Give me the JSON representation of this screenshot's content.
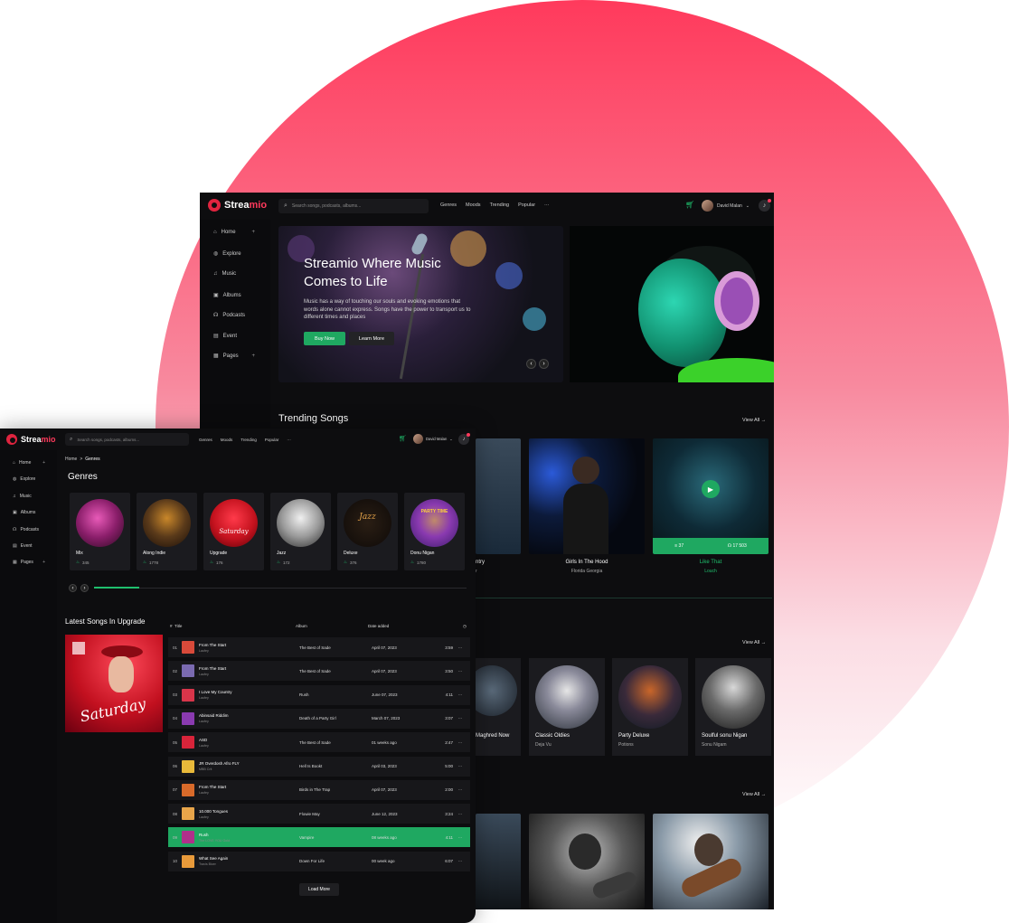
{
  "colors": {
    "accent": "#1fbf6d",
    "brand": "#e0243f",
    "background": "#0d0d0f"
  },
  "app": {
    "name_a": "Strea",
    "name_b": "mio"
  },
  "header": {
    "search_placeholder": "Search songs, podcasts, albums...",
    "nav": [
      "Genres",
      "Moods",
      "Trending",
      "Popular",
      "···"
    ],
    "user_name": "David Malan",
    "icons": [
      "cart-icon",
      "bell-icon",
      "chevron-down-icon",
      "search-icon"
    ]
  },
  "sidebar": {
    "items": [
      {
        "label": "Home",
        "icon": "home-icon",
        "plus": "+"
      },
      {
        "label": "Explore",
        "icon": "globe-icon",
        "plus": ""
      },
      {
        "label": "Music",
        "icon": "music-icon",
        "plus": ""
      },
      {
        "label": "Albums",
        "icon": "album-icon",
        "plus": ""
      },
      {
        "label": "Podcasts",
        "icon": "headphones-icon",
        "plus": ""
      },
      {
        "label": "Event",
        "icon": "calendar-icon",
        "plus": ""
      },
      {
        "label": "Pages",
        "icon": "pages-icon",
        "plus": "+"
      }
    ]
  },
  "hero": {
    "title": "Streamio Where Music Comes to Life",
    "text": "Music has a way of touching our souls and evoking emotions that words alone cannot express. Songs have the power to transport us to different times and places",
    "buy_label": "Buy Now",
    "learn_label": "Learn More",
    "prev": "‹",
    "next": "›"
  },
  "trending": {
    "title": "Trending Songs",
    "view_all": "View All",
    "cards": [
      {
        "title": "Girls In The Hood",
        "artist": "Florida Georgia"
      },
      {
        "title": "Like That",
        "artist": "Louch",
        "likes": "37",
        "plays": "17 503"
      }
    ],
    "partial_title": "ntry",
    "partial_sub": "r"
  },
  "artists": {
    "view_all": "View All",
    "items": [
      {
        "title": "Maghred Now",
        "sub": ""
      },
      {
        "title": "Classic Oldies",
        "sub": "Deja Vu"
      },
      {
        "title": "Party Deluxe",
        "sub": "Potions"
      },
      {
        "title": "Soulful sonu Nigan",
        "sub": "Sonu Nigam"
      }
    ]
  },
  "third_section": {
    "view_all": "View All"
  },
  "front": {
    "breadcrumb_home": "Home",
    "breadcrumb_sep": ">",
    "breadcrumb_current": "Genres",
    "genres_title": "Genres",
    "genres": [
      {
        "name": "Mix",
        "count": "345"
      },
      {
        "name": "Along Indie",
        "count": "1778"
      },
      {
        "name": "Upgrade",
        "count": "176"
      },
      {
        "name": "Jazz",
        "count": "172"
      },
      {
        "name": "Deluxe",
        "count": "376"
      },
      {
        "name": "Donu Nigan",
        "count": "1780"
      }
    ],
    "genre_disc_texts": [
      "",
      "",
      "Saturday",
      "",
      "Jazz",
      "PARTY TIME"
    ],
    "latest_title": "Latest Songs In Upgrade",
    "latest_cover_text": "Saturday",
    "table_headers": {
      "num": "#",
      "title": "Title",
      "album": "Album",
      "date": "Date added"
    },
    "songs": [
      {
        "num": "01",
        "title": "From The Start",
        "artist": "Laufey",
        "album": "The Best of Sade",
        "date": "April 07, 2023",
        "dur": "3:59"
      },
      {
        "num": "02",
        "title": "From The Start",
        "artist": "Laufey",
        "album": "The Best of Sade",
        "date": "April 07, 2023",
        "dur": "3:50"
      },
      {
        "num": "03",
        "title": "I Love My Country",
        "artist": "Laufey",
        "album": "Rush",
        "date": "June 07, 2023",
        "dur": "4:11"
      },
      {
        "num": "04",
        "title": "Abinsaid Riddim",
        "artist": "Laufey",
        "album": "Death of a Party Girl",
        "date": "March 07, 2023",
        "dur": "3:07"
      },
      {
        "num": "05",
        "title": "ASD",
        "artist": "Laufey",
        "album": "The Best of Sade",
        "date": "01 weeks ago",
        "dur": "2:47"
      },
      {
        "num": "06",
        "title": "JR Overdosh Afro FLY",
        "artist": "MBB Crit",
        "album": "Hell Is Bookt",
        "date": "April 03, 2023",
        "dur": "5:00"
      },
      {
        "num": "07",
        "title": "From The Start",
        "artist": "Laufey",
        "album": "Birds in The Trap",
        "date": "April 07, 2023",
        "dur": "2:00"
      },
      {
        "num": "08",
        "title": "10.000 Tongues",
        "artist": "Laufey",
        "album": "Flowie May",
        "date": "June 12, 2023",
        "dur": "3:24"
      },
      {
        "num": "09",
        "title": "Rush",
        "artist": "The LOVE YOU Gold",
        "album": "Vampire",
        "date": "08 weeks ago",
        "dur": "4:11"
      },
      {
        "num": "10",
        "title": "What See Again",
        "artist": "Travis Bicer",
        "album": "Down For Life",
        "date": "00 week ago",
        "dur": "6:07"
      }
    ],
    "more_glyph": "···",
    "load_more": "Load More",
    "slider_prev": "‹",
    "slider_next": "›"
  }
}
